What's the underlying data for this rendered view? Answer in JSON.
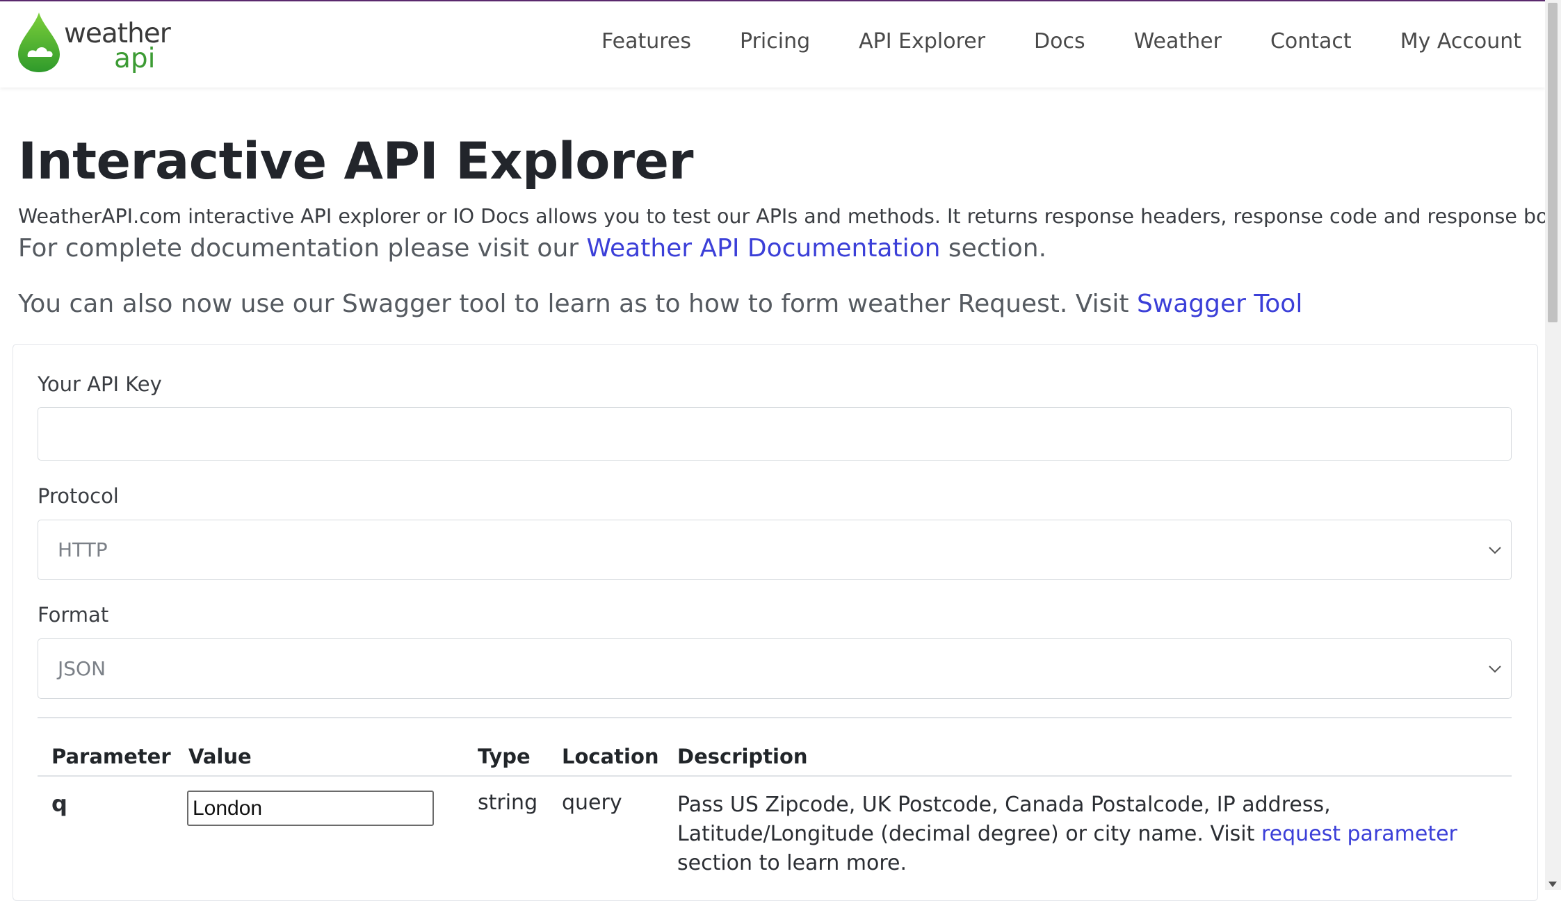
{
  "brand": {
    "name_line1": "weather",
    "name_line2": "api",
    "green": "#3c9b34",
    "icon": "weather-api-logo-drop-icon"
  },
  "nav": {
    "items": [
      {
        "label": "Features"
      },
      {
        "label": "Pricing"
      },
      {
        "label": "API Explorer"
      },
      {
        "label": "Docs"
      },
      {
        "label": "Weather"
      },
      {
        "label": "Contact"
      },
      {
        "label": "My Account"
      }
    ]
  },
  "page": {
    "title": "Interactive API Explorer",
    "intro": "WeatherAPI.com interactive API explorer or IO Docs allows you to test our APIs and methods. It returns response headers, response code and response body.",
    "lead1_prefix": "For complete documentation please visit our ",
    "lead1_link": "Weather API Documentation",
    "lead1_suffix": " section.",
    "lead2_prefix": "You can also now use our Swagger tool to learn as to how to form weather Request. Visit ",
    "lead2_link": "Swagger Tool",
    "link_color": "#3b3fd8"
  },
  "form": {
    "api_key_label": "Your API Key",
    "api_key_value": "",
    "protocol_label": "Protocol",
    "protocol_selected": "HTTP",
    "format_label": "Format",
    "format_selected": "JSON"
  },
  "table": {
    "headers": [
      "Parameter",
      "Value",
      "Type",
      "Location",
      "Description"
    ],
    "rows": [
      {
        "parameter": "q",
        "value": "London",
        "type": "string",
        "location": "query",
        "description_prefix": "Pass US Zipcode, UK Postcode, Canada Postalcode, IP address, Latitude/Longitude (decimal degree) or city name. Visit ",
        "description_link": "request parameter",
        "description_suffix": " section to learn more."
      }
    ]
  }
}
